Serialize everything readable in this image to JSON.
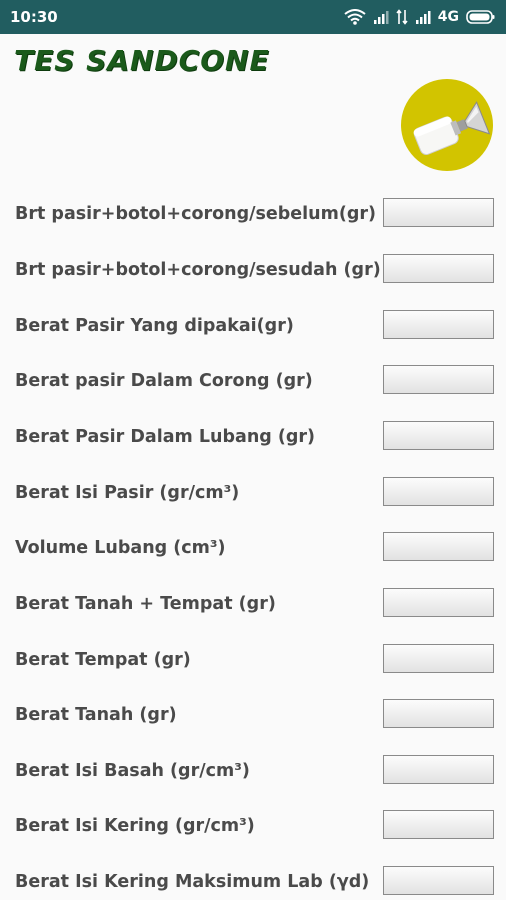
{
  "status_bar": {
    "time": "10:30",
    "network": "4G",
    "icons": [
      "wifi-icon",
      "signal-icon",
      "signal-icon",
      "data-arrows-icon",
      "signal-icon",
      "battery-icon"
    ]
  },
  "app": {
    "title": "TES SANDCONE",
    "logo_icon": "sandcone-icon",
    "title_color": "#1b5a1b",
    "logo_color": "#d2c400"
  },
  "form": {
    "fields": [
      {
        "label": "Brt pasir+botol+corong/sebelum(gr)",
        "value": ""
      },
      {
        "label": "Brt pasir+botol+corong/sesudah (gr)",
        "value": ""
      },
      {
        "label": "Berat Pasir Yang dipakai(gr)",
        "value": ""
      },
      {
        "label": "Berat pasir Dalam Corong (gr)",
        "value": ""
      },
      {
        "label": "Berat Pasir Dalam Lubang (gr)",
        "value": ""
      },
      {
        "label": "Berat Isi Pasir (gr/cm³)",
        "value": ""
      },
      {
        "label": "Volume Lubang (cm³)",
        "value": ""
      },
      {
        "label": "Berat Tanah + Tempat (gr)",
        "value": ""
      },
      {
        "label": "Berat Tempat (gr)",
        "value": ""
      },
      {
        "label": "Berat Tanah (gr)",
        "value": ""
      },
      {
        "label": "Berat Isi Basah (gr/cm³)",
        "value": ""
      },
      {
        "label": "Berat Isi Kering (gr/cm³)",
        "value": ""
      },
      {
        "label": "Berat Isi Kering Maksimum Lab (γd)",
        "value": ""
      }
    ]
  }
}
